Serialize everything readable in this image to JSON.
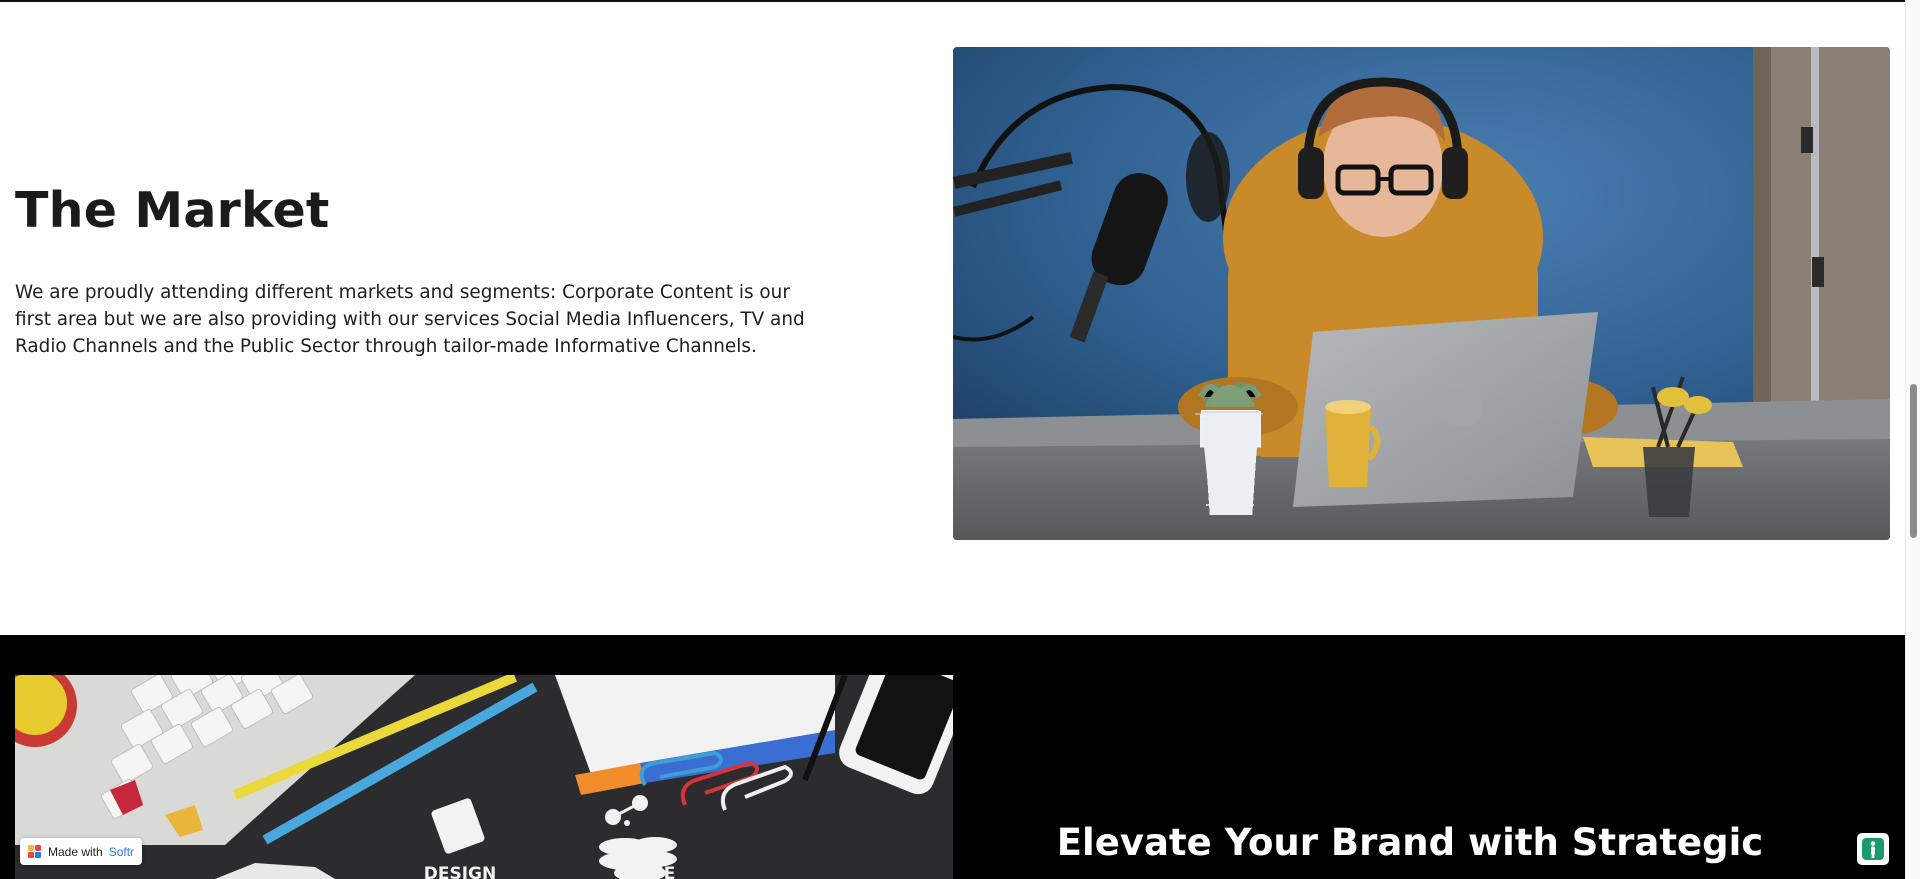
{
  "market": {
    "title": "The Market",
    "body": "We are proudly attending different markets and segments: Corporate Content is our first area but we are also providing with our services Social Media Influencers, TV and Radio Channels and the Public Sector through tailor-made Informative Channels."
  },
  "brand_section": {
    "title": "Elevate Your Brand with Strategic"
  },
  "desk_image_text": {
    "design": "DESIGN",
    "value": "VALUE"
  },
  "softr_badge": {
    "prefix": "Made with",
    "brand": "Softr"
  },
  "colors": {
    "dark_section": "#000000",
    "studio_wall": "#2f5f8f",
    "hoodie": "#c98a2a",
    "softr_blue": "#2d7be5",
    "helper_green": "#1a9b6c"
  },
  "icons": {
    "helper": "person-accessibility-icon",
    "softr": "softr-logo-icon"
  }
}
